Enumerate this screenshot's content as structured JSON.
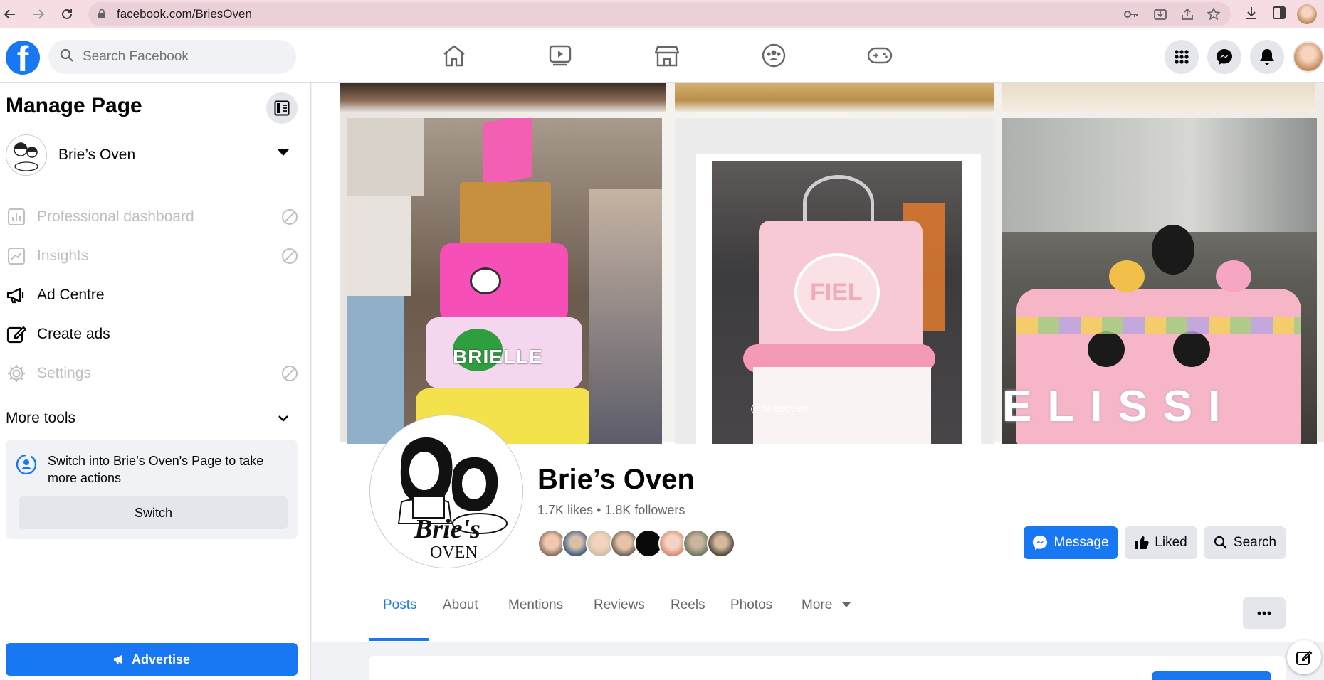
{
  "browser": {
    "url": "facebook.com/BriesOven"
  },
  "header": {
    "search_placeholder": "Search Facebook",
    "nav": [
      "home-icon",
      "watch-icon",
      "marketplace-icon",
      "groups-icon",
      "gaming-icon"
    ]
  },
  "sidebar": {
    "title": "Manage Page",
    "page_name": "Brie’s Oven",
    "items": [
      {
        "label": "Professional dashboard",
        "disabled": true
      },
      {
        "label": "Insights",
        "disabled": true
      },
      {
        "label": "Ad Centre",
        "disabled": false
      },
      {
        "label": "Create ads",
        "disabled": false
      },
      {
        "label": "Settings",
        "disabled": true
      }
    ],
    "more_tools": "More tools",
    "switch_text": "Switch into Brie’s Oven's Page to take more actions",
    "switch_button": "Switch",
    "advertise_button": "Advertise"
  },
  "profile": {
    "name": "Brie’s Oven",
    "stats": "1.7K likes • 1.8K followers",
    "logo_text_1": "Brie's",
    "logo_text_2": "OVEN",
    "cover_watermark": "@briesoven",
    "cover_cake_text_1": "BRIELLE",
    "cover_cake_text_2": "FIEL",
    "cover_cake_text_3": "ELISSI",
    "message_button": "Message",
    "liked_button": "Liked",
    "search_button": "Search"
  },
  "tabs": [
    "Posts",
    "About",
    "Mentions",
    "Reviews",
    "Reels",
    "Photos",
    "More"
  ],
  "colors": {
    "brand": "#1877f2",
    "browser_bar": "#f6dde3"
  }
}
